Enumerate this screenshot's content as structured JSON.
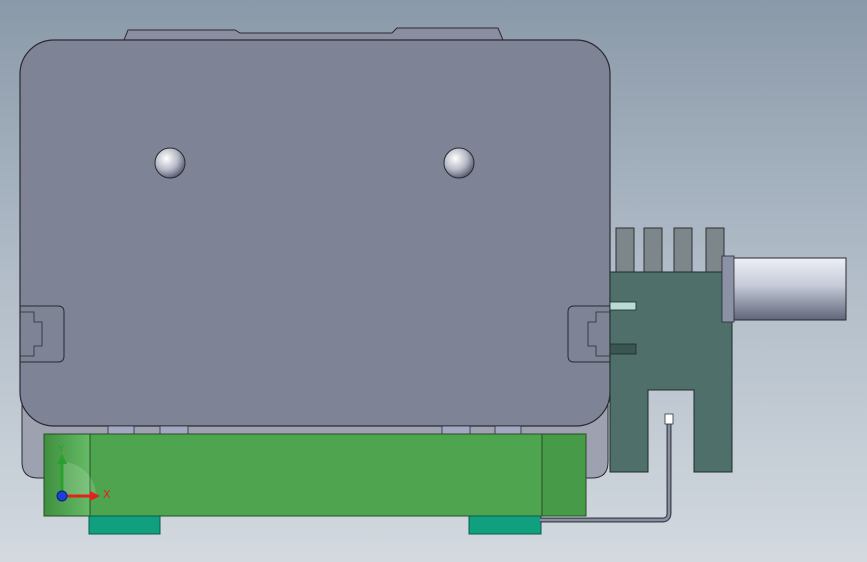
{
  "viewport": {
    "background_top": "#8a99a9",
    "background_bottom": "#d3d9df"
  },
  "model": {
    "housing_color": "#7f8396",
    "housing_edge": "#2a2a30",
    "base_color": "#4fa54f",
    "base_edge": "#244f24",
    "feet_color": "#10a080",
    "connector_color": "#4f6f6b",
    "connector_pins_color": "#7d868a",
    "shaft_color": "#c0c6d6",
    "wire_color": "#555a66"
  },
  "triad": {
    "x_label": "X",
    "y_label": "Y",
    "x_color": "#e0241c",
    "y_color": "#2ca02c",
    "z_color": "#1d3fd6"
  }
}
